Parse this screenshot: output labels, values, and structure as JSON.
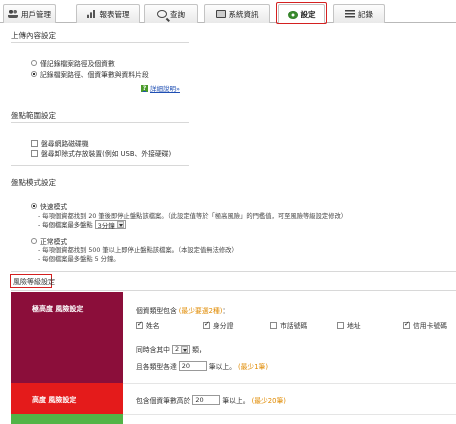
{
  "tabs": [
    {
      "label": "用戶管理",
      "icon": "users-icon"
    },
    {
      "label": "報表管理",
      "icon": "bar-chart-icon"
    },
    {
      "label": "查詢",
      "icon": "search-icon"
    },
    {
      "label": "系統資訊",
      "icon": "monitor-icon"
    },
    {
      "label": "設定",
      "icon": "gear-icon"
    },
    {
      "label": "記錄",
      "icon": "list-icon"
    }
  ],
  "upload": {
    "title": "上傳內容設定",
    "option1": "僅記錄檔案路徑及個資數",
    "option2": "記錄檔案路徑、個資筆數與資料片段",
    "help": "詳細說明»"
  },
  "scope": {
    "title": "盤點範圍設定",
    "option1": "盤尋網路磁碟機",
    "option2": "盤尋卸除式存放裝置(例如 USB、外接硬碟)"
  },
  "mode": {
    "title": "盤點模式設定",
    "quick_label": "快速模式",
    "quick_note1": "- 每項個資都找到 20 筆後即停止盤點該檔案。（此設定值等於「極高風險」的門檻值，可至風險等級設定修改）",
    "quick_note2_pre": "- 每個檔案最多盤點",
    "quick_minutes": "3分鐘",
    "normal_label": "正常模式",
    "normal_note1": "- 每項個資都找到 500 筆以上即停止盤點該檔案。（本設定值無法修改）",
    "normal_note2": "- 每個檔案最多盤點 5 分鐘。"
  },
  "risk": {
    "title": "風險等級設定",
    "very_high_label": "極高度 風險設定",
    "high_label": "高度 風險設定",
    "types_label": "個資類型包含",
    "types_hint": "(最少要選2種)",
    "types_colon": "：",
    "types": [
      {
        "label": "姓名",
        "checked": true
      },
      {
        "label": "身分證",
        "checked": true
      },
      {
        "label": "市話號碼",
        "checked": false
      },
      {
        "label": "地址",
        "checked": false
      },
      {
        "label": "信用卡號碼",
        "checked": true
      }
    ],
    "simul_pre": "同時含其中",
    "simul_value": "2",
    "simul_post": "類，",
    "each_pre": "且各類型各達",
    "each_value": "20",
    "each_post": "筆以上。",
    "each_hint": "(最少1筆)",
    "high_pre": "包含個資筆數高於",
    "high_value": "20",
    "high_post": "筆以上。",
    "high_hint": "(最少20筆)"
  }
}
